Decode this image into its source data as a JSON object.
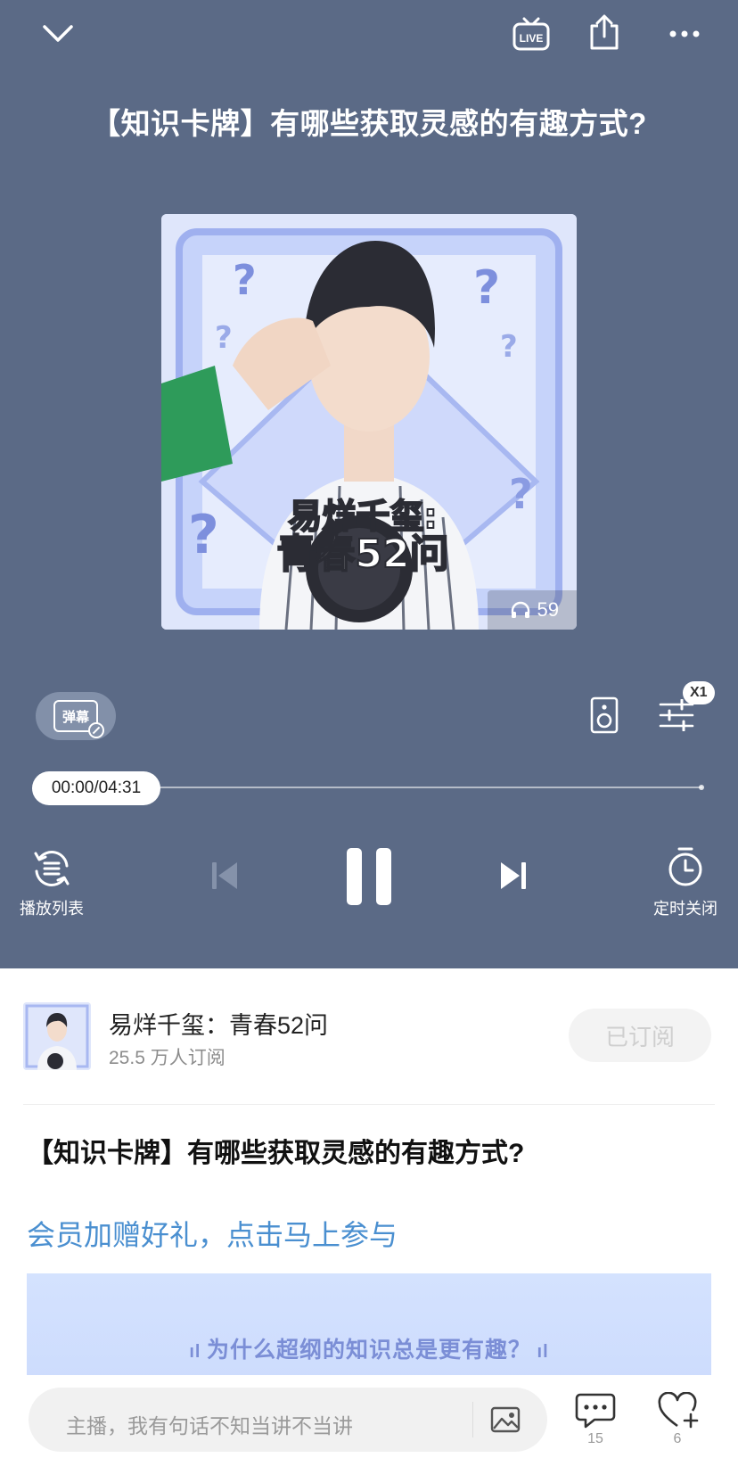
{
  "header": {
    "collapse_icon": "chevron-down-icon",
    "live_label": "LIVE",
    "share_icon": "share-icon",
    "more_icon": "more-icon"
  },
  "episode": {
    "title": "【知识卡牌】有哪些获取灵感的有趣方式?"
  },
  "cover": {
    "play_count": "59",
    "overlay_text_line1": "易烊千玺:",
    "overlay_text_line2": "青春52问"
  },
  "controls": {
    "danmu_label": "弹幕",
    "speed_label": "X1",
    "time_display": "00:00/04:31",
    "progress": 0,
    "playlist_label": "播放列表",
    "timer_label": "定时关闭"
  },
  "album": {
    "name": "易烊千玺：青春52问",
    "subscribers": "25.5 万人订阅",
    "subscribe_status": "已订阅"
  },
  "body": {
    "episode_title": "【知识卡牌】有哪些获取灵感的有趣方式?",
    "promo_link": "会员加赠好礼，点击马上参与",
    "banner_text": "为什么超纲的知识总是更有趣？"
  },
  "bottom_bar": {
    "comment_placeholder": "主播，我有句话不知当讲不当讲",
    "comment_count": "15",
    "like_count": "6"
  },
  "colors": {
    "player_bg": "#5b6a86",
    "link_blue": "#4a8fd0",
    "banner_bg": "#d4e2fe"
  }
}
